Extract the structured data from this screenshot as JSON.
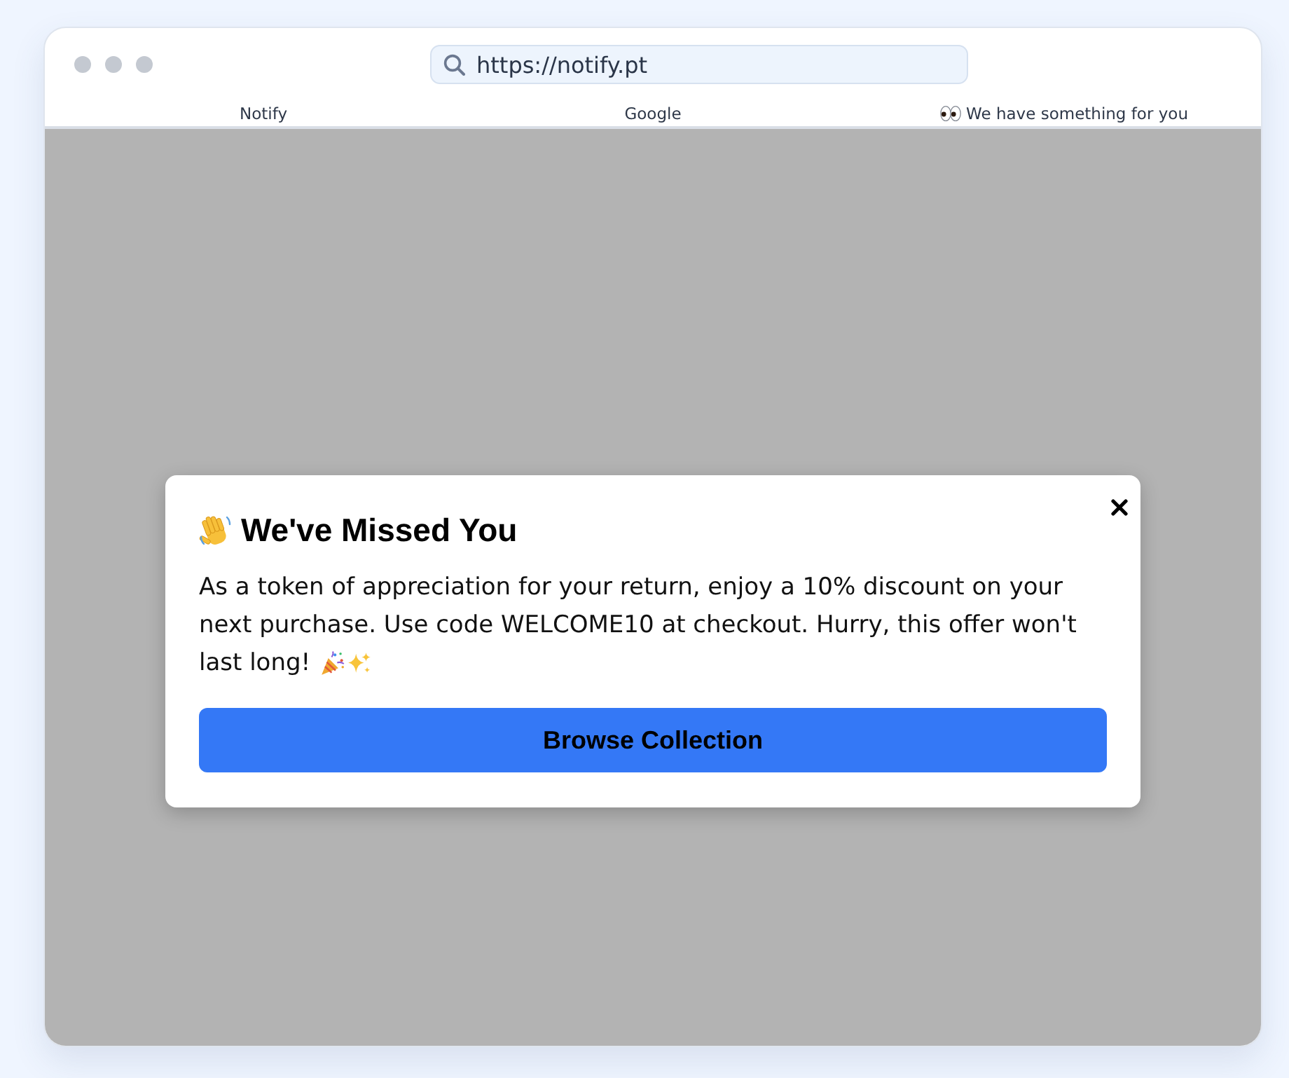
{
  "browser": {
    "address": "https://notify.pt",
    "tabs": [
      {
        "kind": "plain",
        "label": "Notify"
      },
      {
        "kind": "plain",
        "label": "Google"
      },
      {
        "kind": "emoji",
        "label": "We have something for you"
      }
    ]
  },
  "modal": {
    "title": "We've Missed You",
    "message": "As a token of appreciation for your return, enjoy a 10% discount on your next purchase. Use code WELCOME10 at checkout. Hurry, this offer won't last long!",
    "button": "Browse Collection"
  }
}
